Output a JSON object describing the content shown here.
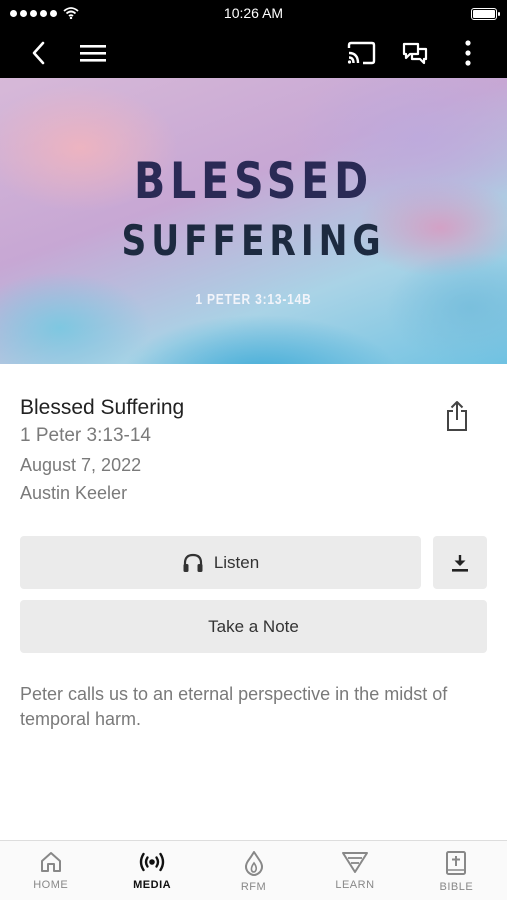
{
  "status": {
    "time": "10:26 AM",
    "battery_level": 1.0
  },
  "nav": {
    "back_icon": "chevron-left-icon",
    "menu_icon": "hamburger-menu-icon",
    "cast_icon": "cast-icon",
    "chat_icon": "chat-bubbles-icon",
    "more_icon": "more-vertical-icon"
  },
  "hero": {
    "line1": "BLESSED",
    "line2": "SUFFERING",
    "reference": "1 PETER 3:13-14B"
  },
  "sermon": {
    "title": "Blessed Suffering",
    "passage": "1 Peter 3:13-14",
    "date": "August 7, 2022",
    "speaker": "Austin Keeler",
    "description": "Peter calls us to an eternal perspective in the midst of temporal harm."
  },
  "actions": {
    "listen_label": "Listen",
    "note_label": "Take a Note",
    "share_icon": "share-icon",
    "download_icon": "download-icon",
    "headphones_icon": "headphones-icon"
  },
  "tabs": [
    {
      "label": "HOME",
      "icon": "home-icon",
      "active": false
    },
    {
      "label": "MEDIA",
      "icon": "broadcast-icon",
      "active": true
    },
    {
      "label": "RFM",
      "icon": "flame-icon",
      "active": false
    },
    {
      "label": "LEARN",
      "icon": "learn-triangle-icon",
      "active": false
    },
    {
      "label": "BIBLE",
      "icon": "bible-icon",
      "active": false
    }
  ],
  "colors": {
    "bar_bg": "#000000",
    "button_bg": "#ebebeb",
    "muted_text": "#7a7a7a"
  }
}
